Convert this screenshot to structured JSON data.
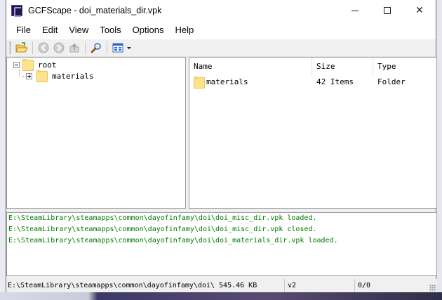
{
  "window": {
    "title": "GCFScape - doi_materials_dir.vpk",
    "controls": {
      "minimize": "minimize",
      "maximize": "maximize",
      "close": "✕"
    }
  },
  "menu": [
    "File",
    "Edit",
    "View",
    "Tools",
    "Options",
    "Help"
  ],
  "toolbar": {
    "buttons": [
      "open-folder-icon",
      "back-icon",
      "forward-icon",
      "up-icon",
      "search-icon",
      "view-mode-icon"
    ]
  },
  "tree": {
    "root_label": "root",
    "children": [
      {
        "label": "materials"
      }
    ]
  },
  "list": {
    "columns": [
      "Name",
      "Size",
      "Type"
    ],
    "rows": [
      {
        "name": "materials",
        "size": "42 Items",
        "type": "Folder"
      }
    ]
  },
  "log": [
    "E:\\SteamLibrary\\steamapps\\common\\dayofinfamy\\doi\\doi_misc_dir.vpk loaded.",
    "E:\\SteamLibrary\\steamapps\\common\\dayofinfamy\\doi\\doi_misc_dir.vpk closed.",
    "E:\\SteamLibrary\\steamapps\\common\\dayofinfamy\\doi\\doi_materials_dir.vpk loaded."
  ],
  "status": {
    "path_size": "E:\\SteamLibrary\\steamapps\\common\\dayofinfamy\\doi\\ 545.46 KB",
    "version": "v2",
    "count": "0/0"
  },
  "colors": {
    "log_text": "#007a00",
    "folder": "#ffe28a",
    "accent": "#1f6fd1"
  }
}
